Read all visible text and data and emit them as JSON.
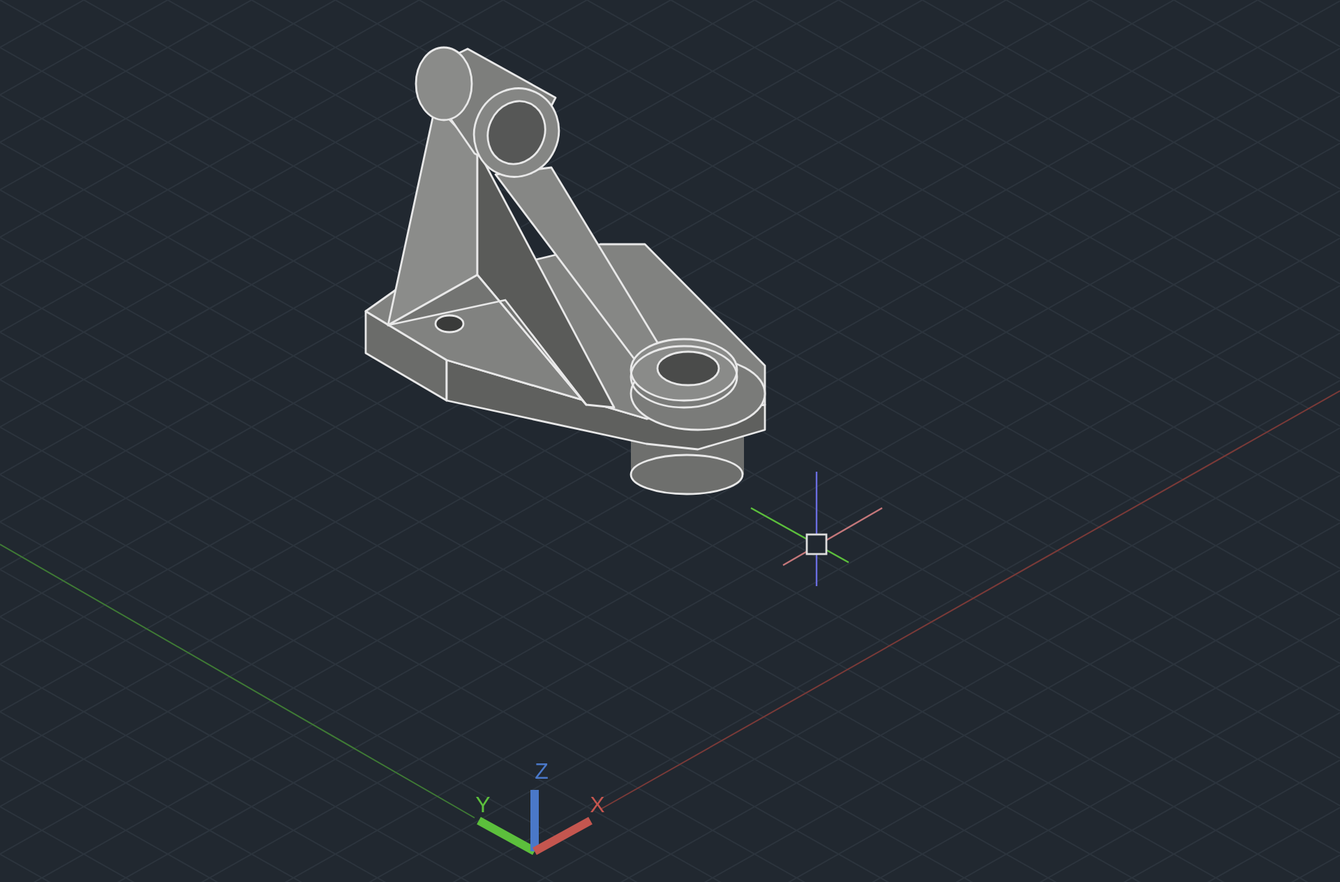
{
  "viewport": {
    "ucs_icon": {
      "axes": [
        {
          "label": "Y",
          "color": "#5cbf3c"
        },
        {
          "label": "Z",
          "color": "#4a78c8"
        },
        {
          "label": "X",
          "color": "#c4564f"
        }
      ]
    }
  }
}
